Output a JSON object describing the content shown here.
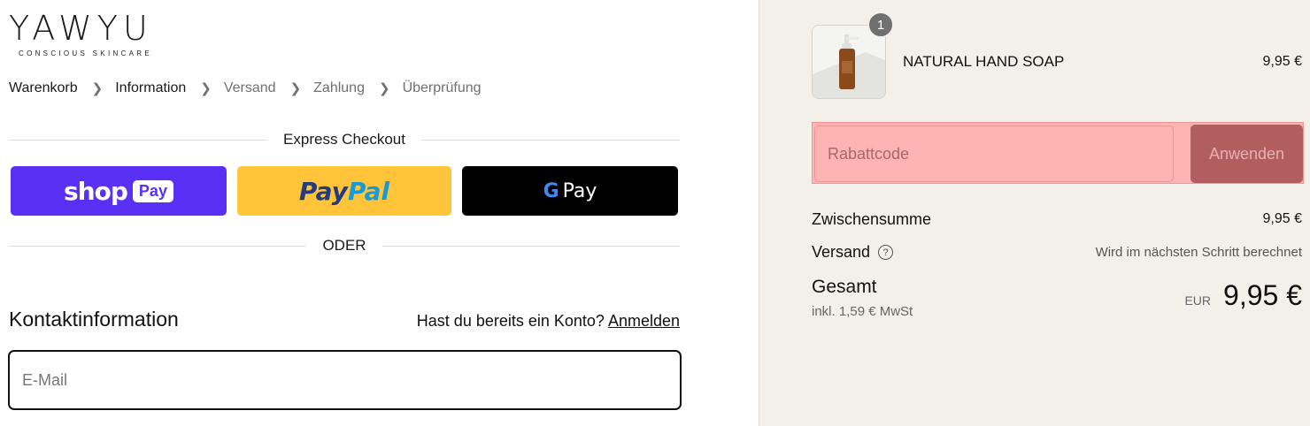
{
  "logo": {
    "main": "YAWYU",
    "sub": "CONSCIOUS SKINCARE"
  },
  "breadcrumb": [
    {
      "label": "Warenkorb"
    },
    {
      "label": "Information"
    },
    {
      "label": "Versand"
    },
    {
      "label": "Zahlung"
    },
    {
      "label": "Überprüfung"
    }
  ],
  "express": {
    "label": "Express Checkout",
    "shop_pay": {
      "word": "shop",
      "tag": "Pay"
    },
    "paypal": {
      "part1": "Pay",
      "part2": "Pal"
    },
    "gpay": {
      "g": "G",
      "pay": "Pay"
    }
  },
  "or_label": "ODER",
  "contact": {
    "title": "Kontaktinformation",
    "account_question": "Hast du bereits ein Konto?",
    "login_link": "Anmelden",
    "email_placeholder": "E-Mail"
  },
  "cart": {
    "item": {
      "name": "NATURAL HAND SOAP",
      "price": "9,95 €",
      "quantity": "1"
    },
    "discount": {
      "placeholder": "Rabattcode",
      "apply_label": "Anwenden"
    },
    "subtotal": {
      "label": "Zwischensumme",
      "value": "9,95 €"
    },
    "shipping": {
      "label": "Versand",
      "value": "Wird im nächsten Schritt berechnet"
    },
    "total": {
      "label": "Gesamt",
      "tax_note": "inkl. 1,59 € MwSt",
      "currency": "EUR",
      "value": "9,95 €"
    }
  },
  "colors": {
    "shop_pay": "#5a31f4",
    "paypal": "#ffc439",
    "gpay": "#000000",
    "summary_bg": "#f3f0ea",
    "discount_highlight": "#ffb3b3",
    "apply_button": "#b25e5e"
  }
}
